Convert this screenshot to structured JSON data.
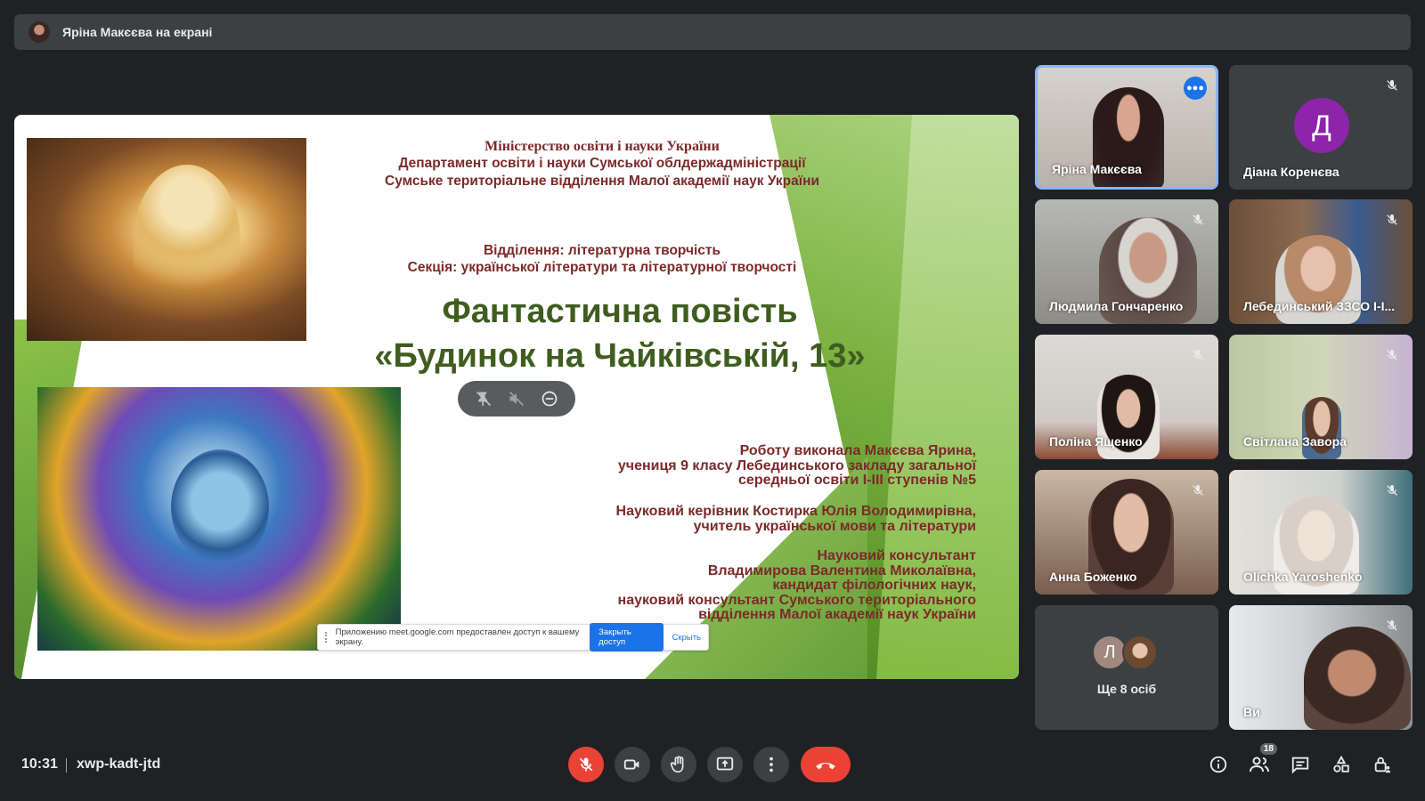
{
  "presenter_banner": {
    "text": "Яріна Макєєва на екрані"
  },
  "slide": {
    "line1": "Міністерство освіти і науки України",
    "line2": "Департамент освіти і науки Сумської облдержадміністрації",
    "line3": "Сумське територіальне відділення Малої академії наук України",
    "line4": "Відділення: літературна творчість",
    "line5": "Секція: української літератури та літературної творчості",
    "title1": "Фантастична повість",
    "title2": "«Будинок на Чайківській, 13»",
    "author": [
      "Роботу виконала Макєєва Ярина,",
      "учениця 9 класу Лебединського закладу загальної",
      "середньої освіти І-ІІІ ступенів №5"
    ],
    "supervisor": [
      "Науковий керівник Костирка Юлія Володимирівна,",
      "учитель української мови та літератури"
    ],
    "consultant": [
      "Науковий консультант",
      "Владимирова Валентина Миколаївна,",
      "кандидат філологічних наук,",
      "науковий консультант Сумського територіального",
      "відділення  Малої академії наук України"
    ]
  },
  "share_notice": {
    "text": "Приложению meet.google.com предоставлен доступ к вашему экрану.",
    "stop_label": "Закрыть доступ",
    "hide_label": "Скрыть"
  },
  "participants": [
    {
      "name": "Яріна Макєєва",
      "active": true
    },
    {
      "name": "Діана Коренєва",
      "initial": "Д",
      "color": "#8e24aa"
    },
    {
      "name": "Людмила Гончаренко"
    },
    {
      "name": "Лебединський ЗЗСО І-І..."
    },
    {
      "name": "Поліна Ященко"
    },
    {
      "name": "Світлана Завора"
    },
    {
      "name": "Анна Боженко"
    },
    {
      "name": "Olichka Yaroshenko"
    },
    {
      "name": "Ще 8 осіб",
      "initial": "Л"
    },
    {
      "name": "Ви"
    }
  ],
  "bottom": {
    "time": "10:31",
    "meeting_code": "xwp-kadt-jtd",
    "participants_count": "18"
  },
  "colors": {
    "bg": "#202124",
    "control": "#3c4043",
    "danger": "#ea4335",
    "accent": "#8ab4f8"
  }
}
